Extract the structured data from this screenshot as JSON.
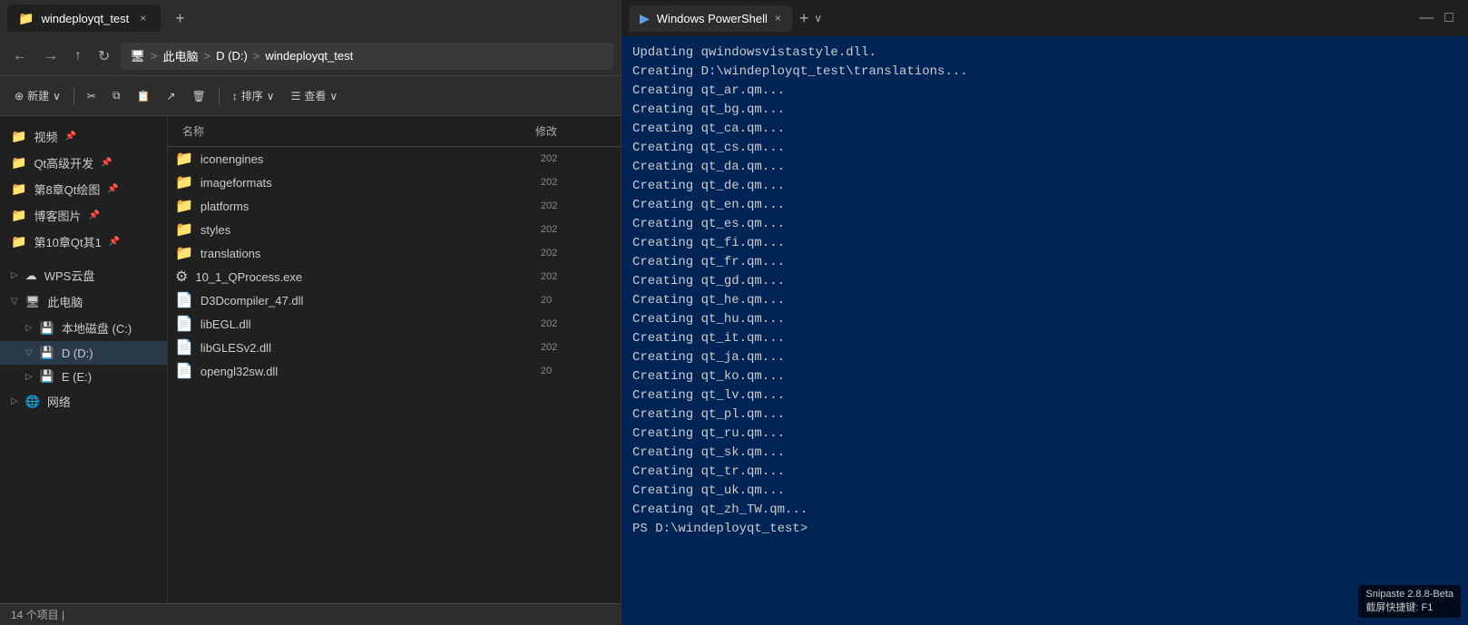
{
  "explorer": {
    "title": "windeployqt_test",
    "tab_close": "×",
    "new_tab": "+",
    "address": {
      "computer": "此电脑",
      "drive": "D (D:)",
      "folder": "windeployqt_test"
    },
    "toolbar": {
      "new": "新建",
      "cut": "",
      "copy": "",
      "paste": "",
      "share": "",
      "delete": "",
      "sort": "排序",
      "view": "查看"
    },
    "sidebar": {
      "items": [
        {
          "label": "视频",
          "type": "folder",
          "indent": 0,
          "pinned": true
        },
        {
          "label": "Qt高级开发",
          "type": "folder",
          "indent": 0,
          "pinned": true
        },
        {
          "label": "第8章Qt绘图",
          "type": "folder",
          "indent": 0,
          "pinned": true
        },
        {
          "label": "博客图片",
          "type": "folder",
          "indent": 0,
          "pinned": true
        },
        {
          "label": "第10章Qt其1",
          "type": "folder",
          "indent": 0,
          "pinned": true
        },
        {
          "label": "WPS云盘",
          "type": "cloud",
          "indent": 0,
          "expand": true
        },
        {
          "label": "此电脑",
          "type": "pc",
          "indent": 0,
          "expand": false
        },
        {
          "label": "本地磁盘 (C:)",
          "type": "drive",
          "indent": 1,
          "expand": true
        },
        {
          "label": "D (D:)",
          "type": "drive",
          "indent": 1,
          "expand": false,
          "selected": true
        },
        {
          "label": "E (E:)",
          "type": "drive",
          "indent": 1,
          "expand": true
        },
        {
          "label": "网络",
          "type": "network",
          "indent": 0,
          "expand": true
        }
      ]
    },
    "files": {
      "header": {
        "name": "名称",
        "date": "修改"
      },
      "items": [
        {
          "name": "iconengines",
          "type": "folder",
          "date": "202"
        },
        {
          "name": "imageformats",
          "type": "folder",
          "date": "202"
        },
        {
          "name": "platforms",
          "type": "folder",
          "date": "202"
        },
        {
          "name": "styles",
          "type": "folder",
          "date": "202"
        },
        {
          "name": "translations",
          "type": "folder",
          "date": "202"
        },
        {
          "name": "10_1_QProcess.exe",
          "type": "exe",
          "date": "202"
        },
        {
          "name": "D3Dcompiler_47.dll",
          "type": "dll",
          "date": "20"
        },
        {
          "name": "libEGL.dll",
          "type": "dll",
          "date": "202"
        },
        {
          "name": "libGLESv2.dll",
          "type": "dll",
          "date": "202"
        },
        {
          "name": "opengl32sw.dll",
          "type": "dll",
          "date": "20"
        }
      ]
    },
    "status": "14 个项目  |"
  },
  "powershell": {
    "title": "Windows PowerShell",
    "tab_close": "×",
    "new_tab": "+",
    "dropdown": "∨",
    "win_minimize": "—",
    "win_maximize": "□",
    "lines": [
      "Updating qwindowsvistastyle.dll.",
      "Creating D:\\windeployqt_test\\translations...",
      "Creating qt_ar.qm...",
      "Creating qt_bg.qm...",
      "Creating qt_ca.qm...",
      "Creating qt_cs.qm...",
      "Creating qt_da.qm...",
      "Creating qt_de.qm...",
      "Creating qt_en.qm...",
      "Creating qt_es.qm...",
      "Creating qt_fi.qm...",
      "Creating qt_fr.qm...",
      "Creating qt_gd.qm...",
      "Creating qt_he.qm...",
      "Creating qt_hu.qm...",
      "Creating qt_it.qm...",
      "Creating qt_ja.qm...",
      "Creating qt_ko.qm...",
      "Creating qt_lv.qm...",
      "Creating qt_pl.qm...",
      "Creating qt_ru.qm...",
      "Creating qt_sk.qm...",
      "Creating qt_tr.qm...",
      "Creating qt_uk.qm...",
      "Creating qt_zh_TW.qm...",
      "PS D:\\windeployqt_test>"
    ]
  },
  "snipaste": {
    "label": "Snipaste 2.8.8-Beta",
    "shortcut": "截屏快捷键: F1"
  }
}
